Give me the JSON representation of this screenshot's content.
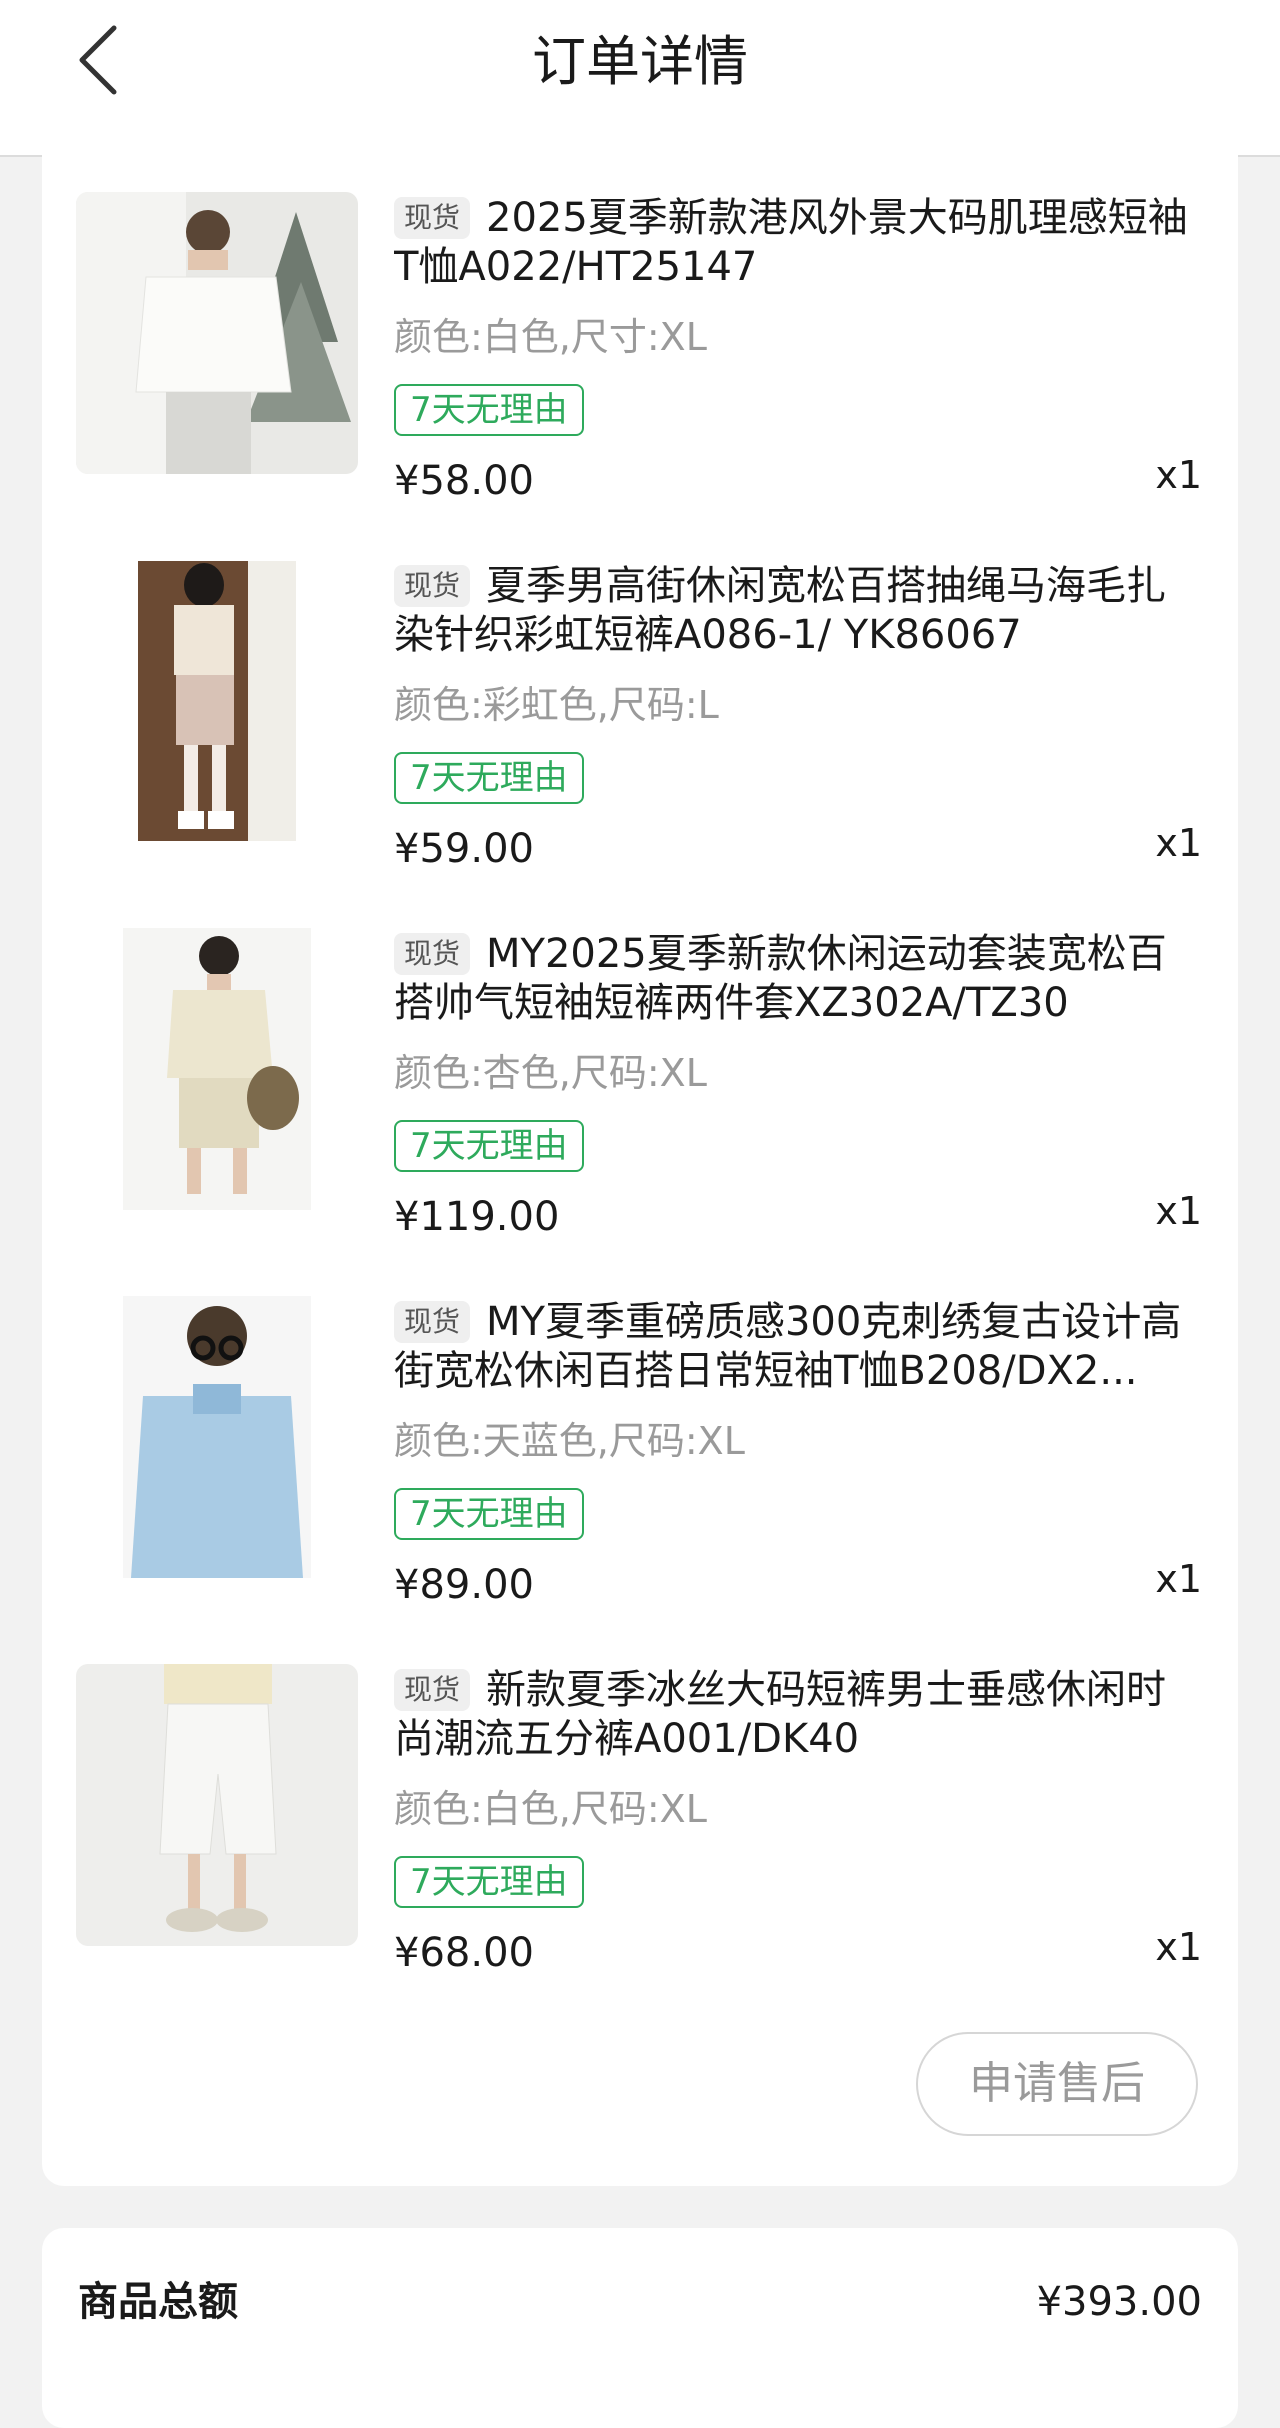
{
  "header": {
    "title": "订单详情",
    "back_icon": "chevron-left-icon"
  },
  "items": [
    {
      "tag": "现货",
      "title": "2025夏季新款港风外景大码肌理感短袖T恤A022/HT25147",
      "spec": "颜色:白色,尺寸:XL",
      "badge": "7天无理由",
      "price": "¥58.00",
      "qty": "x1"
    },
    {
      "tag": "现货",
      "title": "夏季男高街休闲宽松百搭抽绳马海毛扎染针织彩虹短裤A086-1/ YK86067",
      "spec": "颜色:彩虹色,尺码:L",
      "badge": "7天无理由",
      "price": "¥59.00",
      "qty": "x1"
    },
    {
      "tag": "现货",
      "title": "MY2025夏季新款休闲运动套装宽松百搭帅气短袖短裤两件套XZ302A/TZ30",
      "spec": "颜色:杏色,尺码:XL",
      "badge": "7天无理由",
      "price": "¥119.00",
      "qty": "x1"
    },
    {
      "tag": "现货",
      "title": "MY夏季重磅质感300克刺绣复古设计高街宽松休闲百搭日常短袖T恤B208/DX2...",
      "spec": "颜色:天蓝色,尺码:XL",
      "badge": "7天无理由",
      "price": "¥89.00",
      "qty": "x1"
    },
    {
      "tag": "现货",
      "title": "新款夏季冰丝大码短裤男士垂感休闲时尚潮流五分裤A001/DK40",
      "spec": "颜色:白色,尺码:XL",
      "badge": "7天无理由",
      "price": "¥68.00",
      "qty": "x1"
    }
  ],
  "actions": {
    "after_sale_label": "申请售后"
  },
  "summary": {
    "label": "商品总额",
    "value": "¥393.00"
  },
  "colors": {
    "accent_green": "#2eaa5c",
    "muted_text": "#9a9a9a",
    "background": "#f2f2f2"
  }
}
